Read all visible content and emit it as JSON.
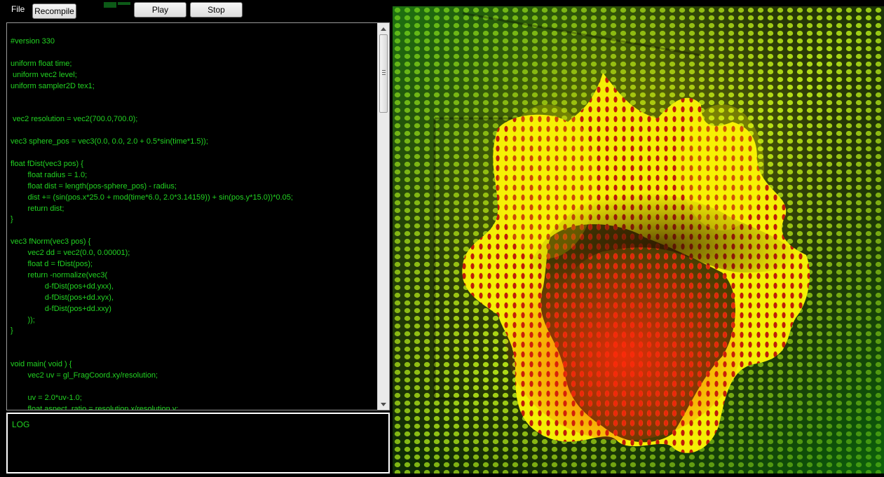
{
  "toolbar": {
    "file_menu": "File",
    "recompile_label": "Recompile",
    "play_label": "Play",
    "stop_label": "Stop"
  },
  "editor": {
    "lines": [
      "#version 330",
      "",
      "uniform float time;",
      " uniform vec2 level;",
      "uniform sampler2D tex1;",
      "",
      "",
      " vec2 resolution = vec2(700.0,700.0);",
      "",
      "vec3 sphere_pos = vec3(0.0, 0.0, 2.0 + 0.5*sin(time*1.5));",
      "",
      "float fDist(vec3 pos) {",
      "\t\tfloat radius = 1.0;",
      "\t\tfloat dist = length(pos-sphere_pos) - radius;",
      "\t\tdist += (sin(pos.x*25.0 + mod(time*6.0, 2.0*3.14159)) + sin(pos.y*15.0))*0.05;",
      "\t\treturn dist;",
      "}",
      "",
      "vec3 fNorm(vec3 pos) {",
      "\t\tvec2 dd = vec2(0.0, 0.00001);",
      "\t\tfloat d = fDist(pos);",
      "\t\treturn -normalize(vec3(",
      "\t\t\t\td-fDist(pos+dd.yxx),",
      "\t\t\t\td-fDist(pos+dd.xyx),",
      "\t\t\t\td-fDist(pos+dd.xxy)",
      "\t\t));",
      "}",
      "",
      "",
      "void main( void ) {",
      "\t\tvec2 uv = gl_FragCoord.xy/resolution;",
      "",
      "\t\tuv = 2.0*uv-1.0;",
      "\t\tfloat aspect_ratio = resolution.x/resolution.y;"
    ]
  },
  "log": {
    "label": "LOG"
  },
  "icons": {
    "scroll_up": "triangle-up-icon",
    "scroll_down": "triangle-down-icon",
    "scroll_grip": "grip-icon"
  },
  "colors": {
    "code_text": "#22d322",
    "background": "#000000",
    "render_yellow": "#f5f000",
    "render_red": "#d01e0a",
    "render_green": "#2fae1c"
  }
}
